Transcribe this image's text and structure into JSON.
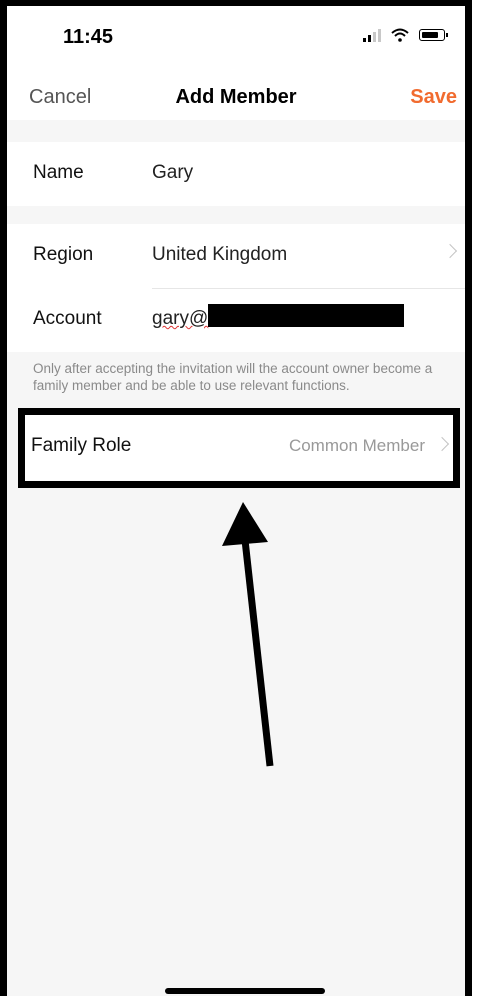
{
  "status_bar": {
    "time": "11:45"
  },
  "nav": {
    "cancel_label": "Cancel",
    "title": "Add Member",
    "save_label": "Save"
  },
  "form": {
    "name": {
      "label": "Name",
      "value": "Gary"
    },
    "region": {
      "label": "Region",
      "value": "United Kingdom"
    },
    "account": {
      "label": "Account",
      "value": "gary@"
    },
    "hint": "Only after accepting the invitation will the account owner become a family member and be able to use relevant functions.",
    "family_role": {
      "label": "Family Role",
      "value": "Common Member"
    }
  },
  "colors": {
    "accent": "#f16b2f",
    "background": "#f6f6f6",
    "annotation": "#000000"
  },
  "icons": [
    "signal-icon",
    "wifi-icon",
    "battery-icon",
    "chevron-right-icon",
    "annotation-arrow"
  ]
}
